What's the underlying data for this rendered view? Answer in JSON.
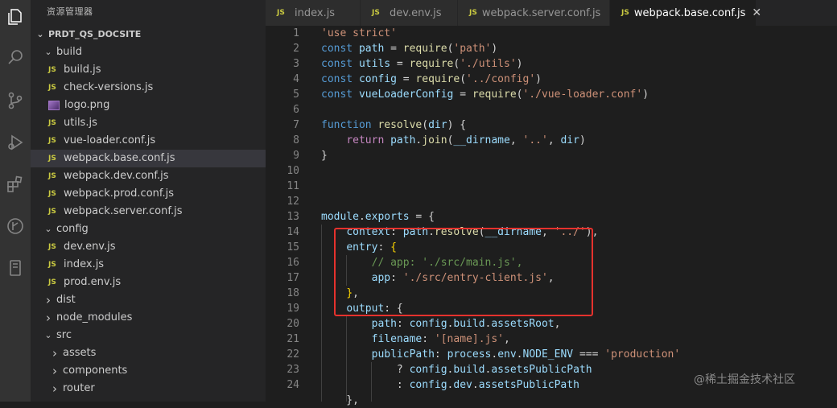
{
  "sidebar": {
    "title": "资源管理器",
    "project": "PRDT_QS_DOCSITE",
    "tree": [
      {
        "label": "build",
        "kind": "folder-open",
        "indent": 1
      },
      {
        "label": "build.js",
        "kind": "js",
        "indent": 2
      },
      {
        "label": "check-versions.js",
        "kind": "js",
        "indent": 2
      },
      {
        "label": "logo.png",
        "kind": "image",
        "indent": 2
      },
      {
        "label": "utils.js",
        "kind": "js",
        "indent": 2
      },
      {
        "label": "vue-loader.conf.js",
        "kind": "js",
        "indent": 2
      },
      {
        "label": "webpack.base.conf.js",
        "kind": "js",
        "indent": 2,
        "selected": true
      },
      {
        "label": "webpack.dev.conf.js",
        "kind": "js",
        "indent": 2
      },
      {
        "label": "webpack.prod.conf.js",
        "kind": "js",
        "indent": 2
      },
      {
        "label": "webpack.server.conf.js",
        "kind": "js",
        "indent": 2
      },
      {
        "label": "config",
        "kind": "folder-open",
        "indent": 1
      },
      {
        "label": "dev.env.js",
        "kind": "js",
        "indent": 2
      },
      {
        "label": "index.js",
        "kind": "js",
        "indent": 2
      },
      {
        "label": "prod.env.js",
        "kind": "js",
        "indent": 2
      },
      {
        "label": "dist",
        "kind": "folder-closed",
        "indent": 1
      },
      {
        "label": "node_modules",
        "kind": "folder-closed",
        "indent": 1
      },
      {
        "label": "src",
        "kind": "folder-open",
        "indent": 1
      },
      {
        "label": "assets",
        "kind": "folder-closed",
        "indent": 2
      },
      {
        "label": "components",
        "kind": "folder-closed",
        "indent": 2
      },
      {
        "label": "router",
        "kind": "folder-closed",
        "indent": 2
      }
    ]
  },
  "tabs": [
    {
      "label": "index.js",
      "active": false
    },
    {
      "label": "dev.env.js",
      "active": false
    },
    {
      "label": "webpack.server.conf.js",
      "active": false
    },
    {
      "label": "webpack.base.conf.js",
      "active": true
    }
  ],
  "badges": {
    "js": "JS",
    "close": "✕"
  },
  "editor": {
    "lines": [
      {
        "n": "1",
        "tokens": [
          [
            "s",
            "'use strict'"
          ]
        ]
      },
      {
        "n": "2",
        "tokens": [
          [
            "k",
            "const "
          ],
          [
            "v",
            "path"
          ],
          [
            "p",
            " = "
          ],
          [
            "f",
            "require"
          ],
          [
            "p",
            "("
          ],
          [
            "s",
            "'path'"
          ],
          [
            "p",
            ")"
          ]
        ]
      },
      {
        "n": "3",
        "tokens": [
          [
            "k",
            "const "
          ],
          [
            "v",
            "utils"
          ],
          [
            "p",
            " = "
          ],
          [
            "f",
            "require"
          ],
          [
            "p",
            "("
          ],
          [
            "s",
            "'./utils'"
          ],
          [
            "p",
            ")"
          ]
        ]
      },
      {
        "n": "4",
        "tokens": [
          [
            "k",
            "const "
          ],
          [
            "v",
            "config"
          ],
          [
            "p",
            " = "
          ],
          [
            "f",
            "require"
          ],
          [
            "p",
            "("
          ],
          [
            "s",
            "'../config'"
          ],
          [
            "p",
            ")"
          ]
        ]
      },
      {
        "n": "5",
        "tokens": [
          [
            "k",
            "const "
          ],
          [
            "v",
            "vueLoaderConfig"
          ],
          [
            "p",
            " = "
          ],
          [
            "f",
            "require"
          ],
          [
            "p",
            "("
          ],
          [
            "s",
            "'./vue-loader.conf'"
          ],
          [
            "p",
            ")"
          ]
        ]
      },
      {
        "n": "6",
        "tokens": []
      },
      {
        "n": "7",
        "tokens": [
          [
            "k",
            "function "
          ],
          [
            "f",
            "resolve"
          ],
          [
            "p",
            "("
          ],
          [
            "v",
            "dir"
          ],
          [
            "p",
            ") {"
          ]
        ]
      },
      {
        "n": "8",
        "tokens": [
          [
            "p",
            "    "
          ],
          [
            "kc",
            "return "
          ],
          [
            "v",
            "path"
          ],
          [
            "p",
            "."
          ],
          [
            "f",
            "join"
          ],
          [
            "p",
            "("
          ],
          [
            "v",
            "__dirname"
          ],
          [
            "p",
            ", "
          ],
          [
            "s",
            "'..'"
          ],
          [
            "p",
            ", "
          ],
          [
            "v",
            "dir"
          ],
          [
            "p",
            ")"
          ]
        ]
      },
      {
        "n": "9",
        "tokens": [
          [
            "p",
            "}"
          ]
        ]
      },
      {
        "n": "10",
        "tokens": []
      },
      {
        "n": "11",
        "tokens": []
      },
      {
        "n": "12",
        "tokens": []
      },
      {
        "n": "13",
        "tokens": [
          [
            "v",
            "module"
          ],
          [
            "p",
            "."
          ],
          [
            "v",
            "exports"
          ],
          [
            "p",
            " = {"
          ]
        ]
      },
      {
        "n": "14",
        "tokens": [
          [
            "p",
            "    "
          ],
          [
            "v",
            "context"
          ],
          [
            "p",
            ": "
          ],
          [
            "v",
            "path"
          ],
          [
            "p",
            "."
          ],
          [
            "f",
            "resolve"
          ],
          [
            "p",
            "("
          ],
          [
            "v",
            "__dirname"
          ],
          [
            "p",
            ", "
          ],
          [
            "s",
            "'../'"
          ],
          [
            "p",
            "),"
          ]
        ]
      },
      {
        "n": "15",
        "tokens": [
          [
            "p",
            "    "
          ],
          [
            "v",
            "entry"
          ],
          [
            "p",
            ": "
          ],
          [
            "b",
            "{"
          ]
        ]
      },
      {
        "n": "16",
        "tokens": [
          [
            "p",
            "        "
          ],
          [
            "c",
            "// app: './src/main.js',"
          ]
        ]
      },
      {
        "n": "17",
        "tokens": [
          [
            "p",
            "        "
          ],
          [
            "v",
            "app"
          ],
          [
            "p",
            ": "
          ],
          [
            "s",
            "'./src/entry-client.js'"
          ],
          [
            "p",
            ","
          ]
        ]
      },
      {
        "n": "18",
        "tokens": [
          [
            "p",
            "    "
          ],
          [
            "b",
            "}"
          ],
          [
            "p",
            ","
          ]
        ]
      },
      {
        "n": "19",
        "tokens": [
          [
            "p",
            "    "
          ],
          [
            "v",
            "output"
          ],
          [
            "p",
            ": {"
          ]
        ]
      },
      {
        "n": "20",
        "tokens": [
          [
            "p",
            "        "
          ],
          [
            "v",
            "path"
          ],
          [
            "p",
            ": "
          ],
          [
            "v",
            "config"
          ],
          [
            "p",
            "."
          ],
          [
            "v",
            "build"
          ],
          [
            "p",
            "."
          ],
          [
            "v",
            "assetsRoot"
          ],
          [
            "p",
            ","
          ]
        ]
      },
      {
        "n": "21",
        "tokens": [
          [
            "p",
            "        "
          ],
          [
            "v",
            "filename"
          ],
          [
            "p",
            ": "
          ],
          [
            "s",
            "'[name].js'"
          ],
          [
            "p",
            ","
          ]
        ]
      },
      {
        "n": "22",
        "tokens": [
          [
            "p",
            "        "
          ],
          [
            "v",
            "publicPath"
          ],
          [
            "p",
            ": "
          ],
          [
            "v",
            "process"
          ],
          [
            "p",
            "."
          ],
          [
            "v",
            "env"
          ],
          [
            "p",
            "."
          ],
          [
            "v",
            "NODE_ENV"
          ],
          [
            "p",
            " === "
          ],
          [
            "s",
            "'production'"
          ]
        ]
      },
      {
        "n": "23",
        "tokens": [
          [
            "p",
            "            ? "
          ],
          [
            "v",
            "config"
          ],
          [
            "p",
            "."
          ],
          [
            "v",
            "build"
          ],
          [
            "p",
            "."
          ],
          [
            "v",
            "assetsPublicPath"
          ]
        ]
      },
      {
        "n": "24",
        "tokens": [
          [
            "p",
            "            : "
          ],
          [
            "v",
            "config"
          ],
          [
            "p",
            "."
          ],
          [
            "v",
            "dev"
          ],
          [
            "p",
            "."
          ],
          [
            "v",
            "assetsPublicPath"
          ]
        ]
      },
      {
        "n": "",
        "tokens": [
          [
            "p",
            "    },"
          ]
        ]
      }
    ]
  },
  "watermark": "@稀土掘金技术社区"
}
